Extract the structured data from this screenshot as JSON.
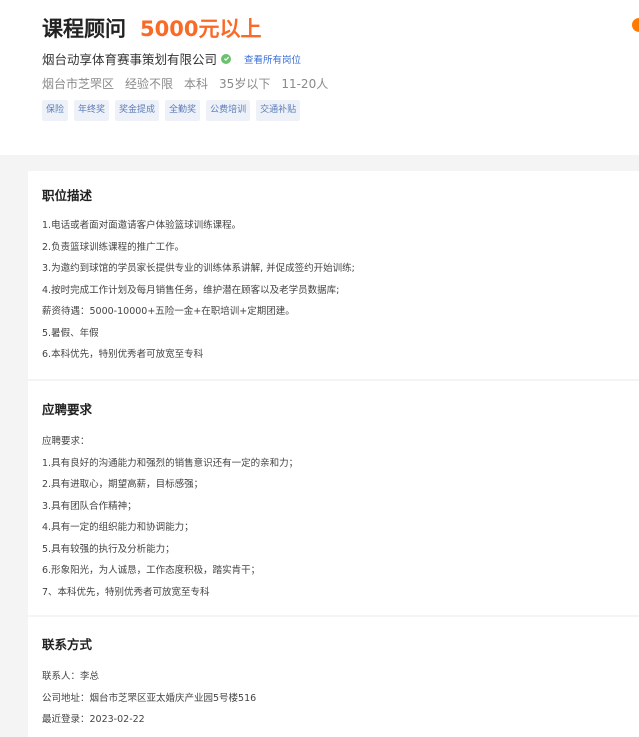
{
  "job": {
    "title": "课程顾问",
    "salary": "5000元以上",
    "company": "烟台动享体育赛事策划有限公司",
    "view_all": "查看所有岗位",
    "meta": [
      "烟台市芝罘区",
      "经验不限",
      "本科",
      "35岁以下",
      "11-20人"
    ],
    "tags": [
      "保险",
      "年终奖",
      "奖金提成",
      "全勤奖",
      "公费培训",
      "交通补贴"
    ]
  },
  "description": {
    "heading": "职位描述",
    "lines": [
      "1.电话或者面对面邀请客户体验篮球训练课程。",
      "2.负责篮球训练课程的推广工作。",
      "3.为邀约到球馆的学员家长提供专业的训练体系讲解, 并促成签约开始训练;",
      "4.按时完成工作计划及每月销售任务，维护潜在顾客以及老学员数据库;",
      "薪资待遇：5000-10000+五险一金+在职培训+定期团建。",
      "5.暑假、年假",
      "6.本科优先，特别优秀者可放宽至专科"
    ]
  },
  "requirements": {
    "heading": "应聘要求",
    "lines": [
      "应聘要求：",
      "1.具有良好的沟通能力和强烈的销售意识还有一定的亲和力；",
      "2.具有进取心，期望高薪，目标感强；",
      "3.具有团队合作精神；",
      "4.具有一定的组织能力和协调能力；",
      "5.具有较强的执行及分析能力；",
      "6.形象阳光，为人诚恳，工作态度积极，踏实肯干；",
      "7、本科优先，特别优秀者可放宽至专科"
    ]
  },
  "contact": {
    "heading": "联系方式",
    "lines": [
      "联系人：李总",
      "公司地址：烟台市芝罘区亚太婚庆产业园5号楼516",
      "最近登录：2023-02-22"
    ]
  },
  "colors": {
    "salary": "#fa6a27",
    "link": "#3a6fd8",
    "tag_text": "#5b7bb7",
    "tag_bg": "#eef2f8",
    "verified": "#6ac16e"
  },
  "icons": {
    "verified": "verified-check-icon"
  }
}
